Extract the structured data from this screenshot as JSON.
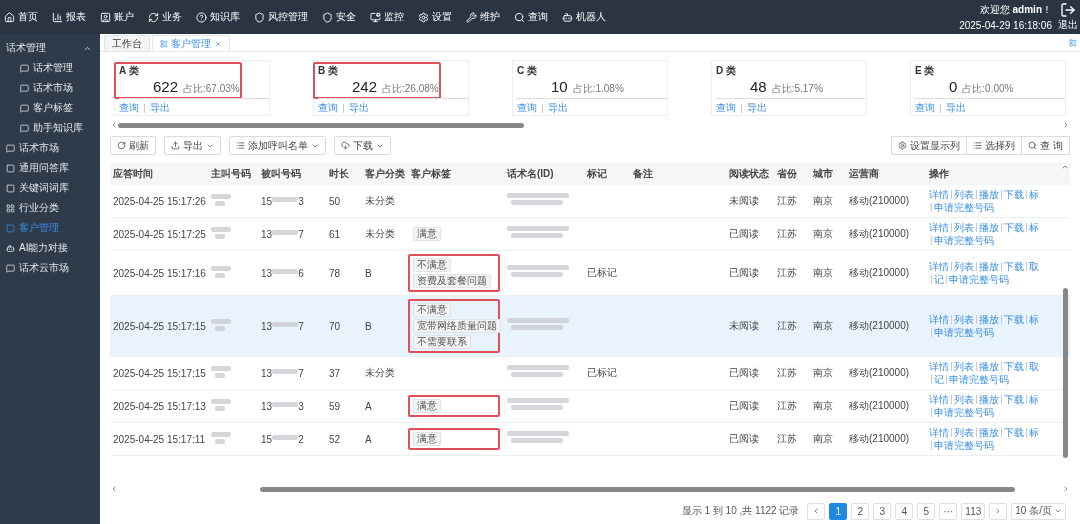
{
  "top_nav": {
    "items": [
      {
        "label": "首页"
      },
      {
        "label": "报表"
      },
      {
        "label": "账户"
      },
      {
        "label": "业务"
      },
      {
        "label": "知识库"
      },
      {
        "label": "风控管理"
      },
      {
        "label": "安全"
      },
      {
        "label": "监控"
      },
      {
        "label": "设置"
      },
      {
        "label": "维护"
      },
      {
        "label": "查询"
      },
      {
        "label": "机器人"
      }
    ],
    "welcome": "欢迎您 **admin**！",
    "datetime": "2025-04-29 16:18:06",
    "logout": "退出"
  },
  "sidebar": {
    "items": [
      {
        "label": "话术管理",
        "expanded": true,
        "selected": false,
        "children": [
          {
            "label": "话术管理",
            "selected": false
          },
          {
            "label": "话术市场",
            "selected": false
          },
          {
            "label": "客户标签",
            "selected": false
          },
          {
            "label": "助手知识库",
            "selected": false
          }
        ]
      },
      {
        "label": "话术市场",
        "selected": false
      },
      {
        "label": "通用问答库",
        "selected": false
      },
      {
        "label": "关键词词库",
        "selected": false
      },
      {
        "label": "行业分类",
        "selected": false
      },
      {
        "label": "客户管理",
        "selected": true
      },
      {
        "label": "AI能力对接",
        "selected": false
      },
      {
        "label": "话术云市场",
        "selected": false
      }
    ]
  },
  "tabs": [
    {
      "label": "工作台",
      "selected": false,
      "closable": false
    },
    {
      "label": "客户管理",
      "selected": true,
      "closable": true
    }
  ],
  "stat_cards": [
    {
      "title": "A 类",
      "count": "622",
      "ratio": "占比:67.03%",
      "links": [
        "查询",
        "导出"
      ],
      "highlighted": true
    },
    {
      "title": "B 类",
      "count": "242",
      "ratio": "占比:26.08%",
      "links": [
        "查询",
        "导出"
      ],
      "highlighted": true
    },
    {
      "title": "C 类",
      "count": "10",
      "ratio": "占比:1.08%",
      "links": [
        "查询",
        "导出"
      ],
      "highlighted": false
    },
    {
      "title": "D 类",
      "count": "48",
      "ratio": "占比:5.17%",
      "links": [
        "查询",
        "导出"
      ],
      "highlighted": false
    },
    {
      "title": "E 类",
      "count": "0",
      "ratio": "占比:0.00%",
      "links": [
        "查询",
        "导出"
      ],
      "highlighted": false
    }
  ],
  "toolbar": {
    "left": [
      {
        "label": "刷新",
        "dropdown": false
      },
      {
        "label": "导出",
        "dropdown": true
      },
      {
        "label": "添加呼叫名单",
        "dropdown": true
      },
      {
        "label": "下载",
        "dropdown": true
      }
    ],
    "right": [
      {
        "label": "设置显示列"
      },
      {
        "label": "选择列"
      },
      {
        "label": "查 询"
      }
    ]
  },
  "table": {
    "columns": [
      "应答时间",
      "主叫号码",
      "被叫号码",
      "时长",
      "客户分类",
      "客户标签",
      "话术名(ID)",
      "标记",
      "备注",
      "阅读状态",
      "省份",
      "城市",
      "运营商",
      "操作"
    ],
    "rows": [
      {
        "selected": false,
        "time": "2025-04-25 15:17:26",
        "callee_start": "15",
        "callee_end": "3",
        "duration": "50",
        "category": "未分类",
        "tags": [],
        "tags_highlighted": false,
        "mark": "",
        "read": "未阅读",
        "province": "江苏",
        "city": "南京",
        "carrier": "移动(210000)",
        "actions": [
          "详情",
          "列表",
          "播放",
          "下载",
          "标"
        ],
        "actions_2": [
          "申请完整号码"
        ]
      },
      {
        "selected": false,
        "time": "2025-04-25 15:17:25",
        "callee_start": "13",
        "callee_end": "7",
        "duration": "61",
        "category": "未分类",
        "tags": [
          "满意"
        ],
        "tags_highlighted": false,
        "mark": "",
        "read": "已阅读",
        "province": "江苏",
        "city": "南京",
        "carrier": "移动(210000)",
        "actions": [
          "详情",
          "列表",
          "播放",
          "下载",
          "标"
        ],
        "actions_2": [
          "申请完整号码"
        ]
      },
      {
        "selected": false,
        "time": "2025-04-25 15:17:16",
        "callee_start": "13",
        "callee_end": "6",
        "duration": "78",
        "category": "B",
        "tags": [
          "不满意",
          "资费及套餐问题"
        ],
        "tags_highlighted": true,
        "mark": "已标记",
        "read": "已阅读",
        "province": "江苏",
        "city": "南京",
        "carrier": "移动(210000)",
        "actions": [
          "详情",
          "列表",
          "播放",
          "下载",
          "取"
        ],
        "actions_2": [
          "记",
          "申请完整号码"
        ]
      },
      {
        "selected": true,
        "time": "2025-04-25 15:17:15",
        "callee_start": "13",
        "callee_end": "7",
        "duration": "70",
        "category": "B",
        "tags": [
          "不满意",
          "宽带网络质量问题",
          "不需要联系"
        ],
        "tags_highlighted": true,
        "mark": "",
        "read": "未阅读",
        "province": "江苏",
        "city": "南京",
        "carrier": "移动(210000)",
        "actions": [
          "详情",
          "列表",
          "播放",
          "下载",
          "标"
        ],
        "actions_2": [
          "申请完整号码"
        ]
      },
      {
        "selected": false,
        "time": "2025-04-25 15:17:15",
        "callee_start": "13",
        "callee_end": "7",
        "duration": "37",
        "category": "未分类",
        "tags": [],
        "tags_highlighted": false,
        "mark": "已标记",
        "read": "已阅读",
        "province": "江苏",
        "city": "南京",
        "carrier": "移动(210000)",
        "actions": [
          "详情",
          "列表",
          "播放",
          "下载",
          "取"
        ],
        "actions_2": [
          "记",
          "申请完整号码"
        ]
      },
      {
        "selected": false,
        "time": "2025-04-25 15:17:13",
        "callee_start": "13",
        "callee_end": "3",
        "duration": "59",
        "category": "A",
        "tags": [
          "满意"
        ],
        "tags_highlighted": true,
        "mark": "",
        "read": "已阅读",
        "province": "江苏",
        "city": "南京",
        "carrier": "移动(210000)",
        "actions": [
          "详情",
          "列表",
          "播放",
          "下载",
          "标"
        ],
        "actions_2": [
          "申请完整号码"
        ]
      },
      {
        "selected": false,
        "time": "2025-04-25 15:17:11",
        "callee_start": "15",
        "callee_end": "2",
        "duration": "52",
        "category": "A",
        "tags": [
          "满意"
        ],
        "tags_highlighted": true,
        "mark": "",
        "read": "已阅读",
        "province": "江苏",
        "city": "南京",
        "carrier": "移动(210000)",
        "actions": [
          "详情",
          "列表",
          "播放",
          "下载",
          "标"
        ],
        "actions_2": [
          "申请完整号码"
        ]
      }
    ]
  },
  "pagination": {
    "summary": "显示 1 到 10 ,共 1122 记录",
    "pages": [
      {
        "label": "1",
        "selected": true
      },
      {
        "label": "2",
        "selected": false
      },
      {
        "label": "3",
        "selected": false
      },
      {
        "label": "4",
        "selected": false
      },
      {
        "label": "5",
        "selected": false
      },
      {
        "label": "···",
        "selected": false
      },
      {
        "label": "113",
        "selected": false
      }
    ],
    "page_size": "10 条/页"
  }
}
